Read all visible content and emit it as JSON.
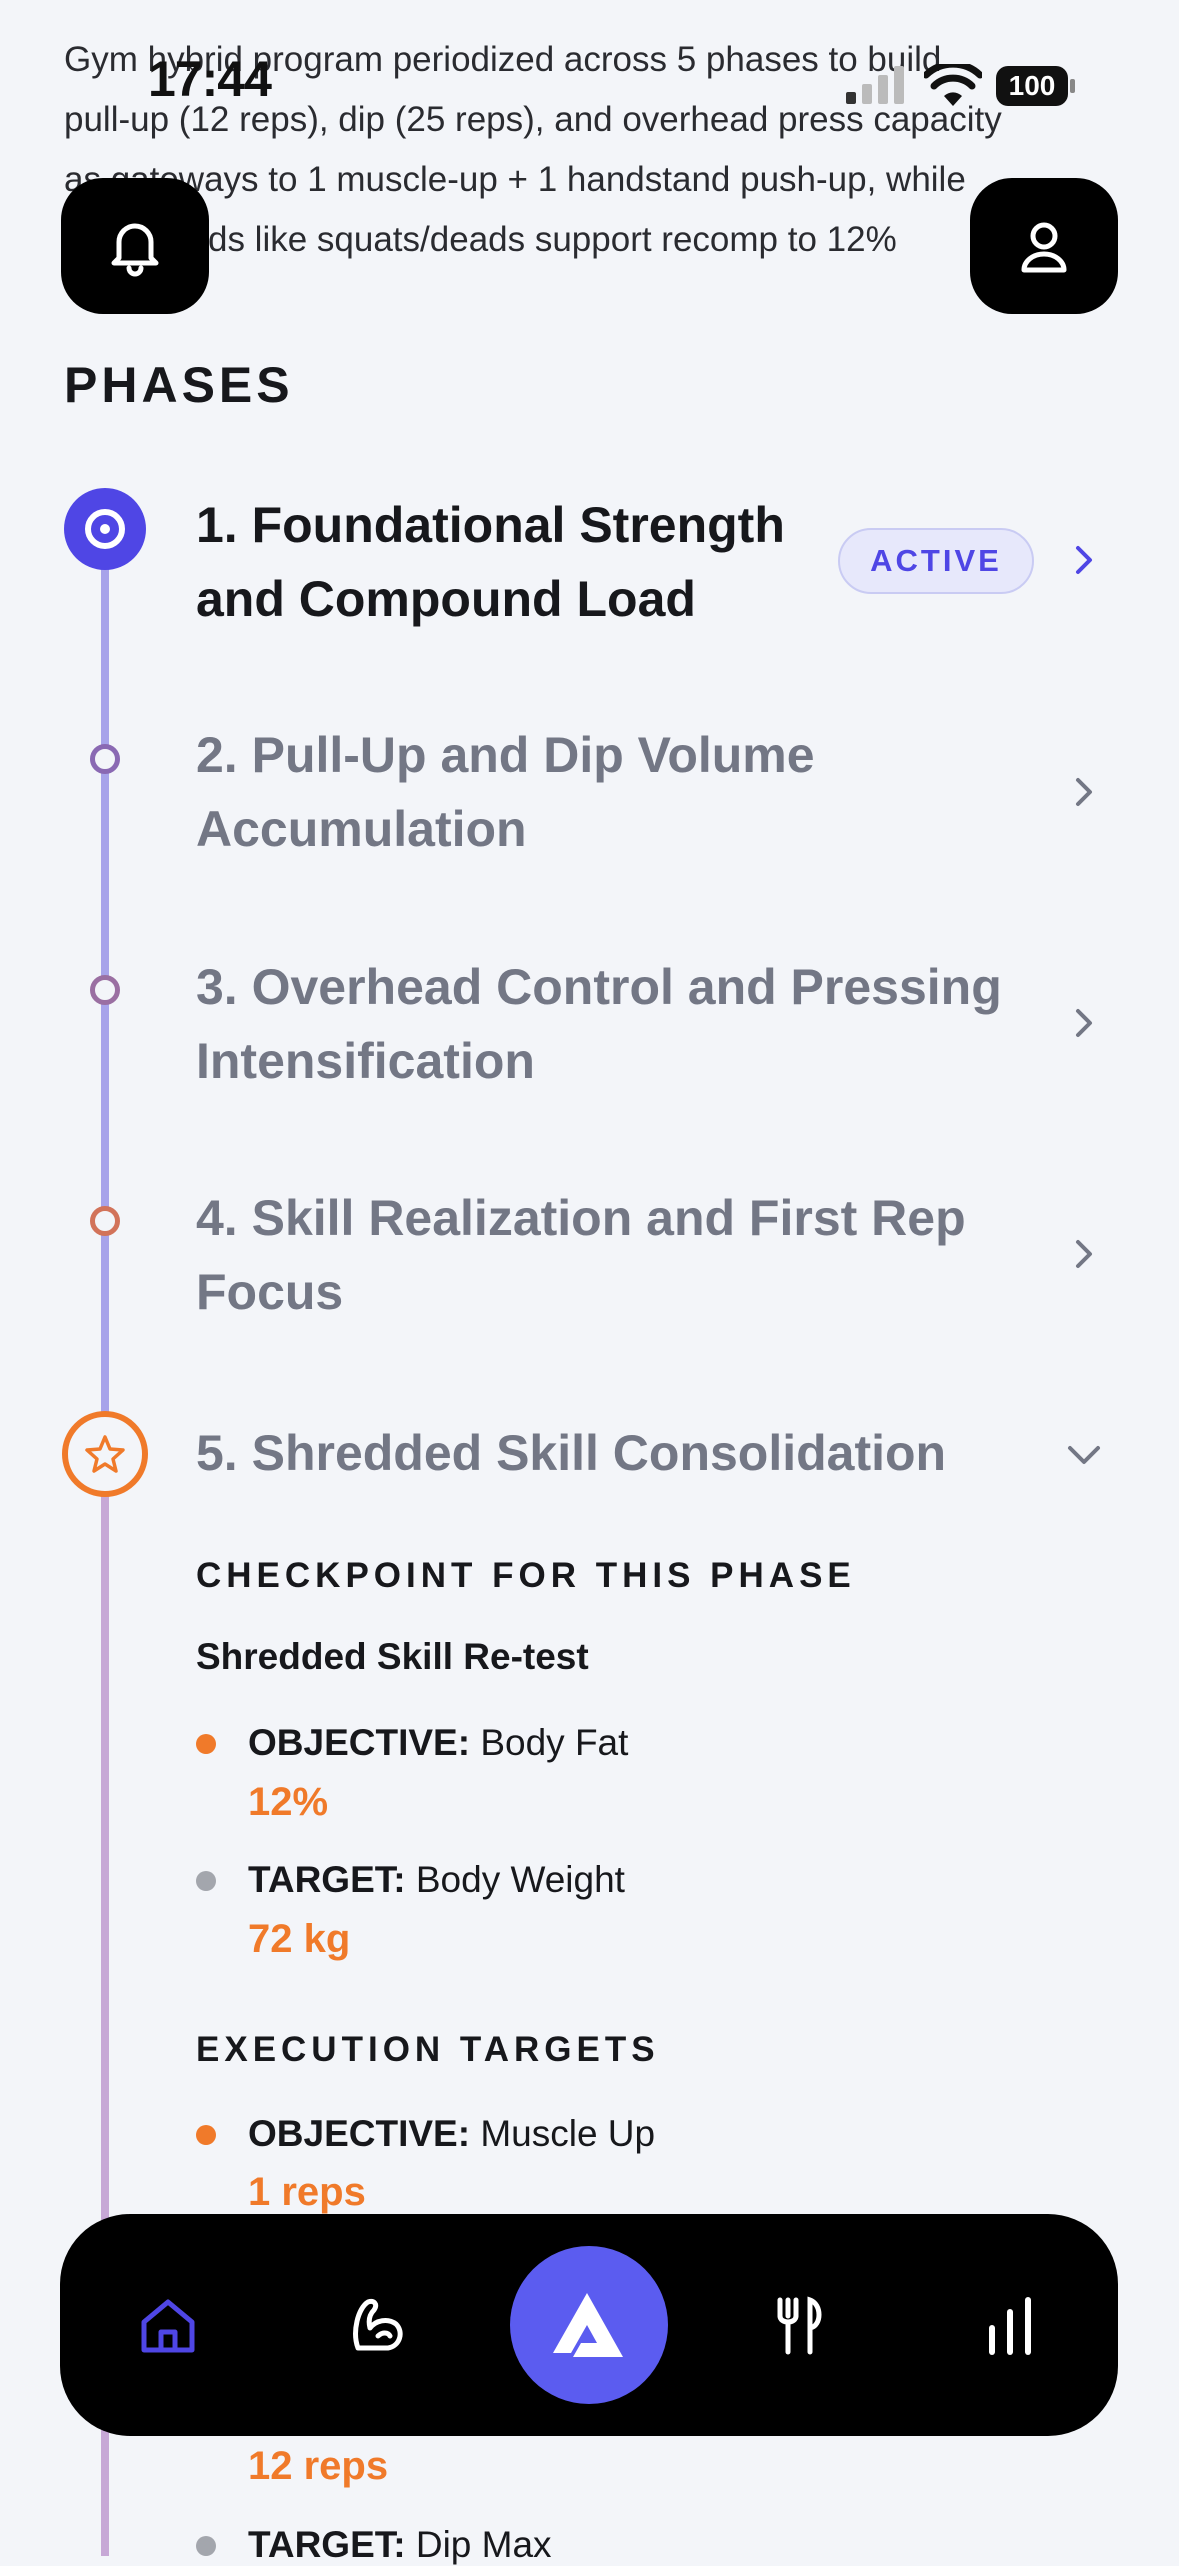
{
  "status_bar": {
    "time": "17:44",
    "battery": "100"
  },
  "intro_lines": [
    "Gym hybrid program periodized across 5 phases to build",
    "pull-up (12 reps), dip (25 reps), and overhead press capacity",
    "as gateways to 1 muscle-up + 1 handstand push-up, while",
    "compounds like squats/deads support recomp to 12%"
  ],
  "section_title": "PHASES",
  "phases": [
    {
      "title": "1. Foundational Strength and Compound Load",
      "badge": "ACTIVE",
      "state": "active"
    },
    {
      "title": "2. Pull-Up and Dip Volume Accumulation",
      "state": "upcoming"
    },
    {
      "title": "3. Overhead Control and Pressing Intensification",
      "state": "upcoming"
    },
    {
      "title": "4. Skill Realization and First Rep Focus",
      "state": "upcoming"
    },
    {
      "title": "5. Shredded Skill Consolidation",
      "state": "expanded"
    }
  ],
  "phase5": {
    "checkpoint_heading": "CHECKPOINT FOR THIS PHASE",
    "checkpoint_name": "Shredded Skill Re-test",
    "checkpoint_items": [
      {
        "kind": "OBJECTIVE:",
        "metric": "Body Fat",
        "value": "12%"
      },
      {
        "kind": "TARGET:",
        "metric": "Body Weight",
        "value": "72 kg"
      }
    ],
    "execution_heading": "EXECUTION TARGETS",
    "execution_items": [
      {
        "kind": "OBJECTIVE:",
        "metric": "Muscle Up",
        "value": "1 reps"
      },
      {
        "value": "12 reps"
      },
      {
        "kind": "TARGET:",
        "metric": "Dip Max"
      }
    ]
  },
  "colors": {
    "accent": "#4f46e5",
    "orange": "#f07a2a",
    "timeline_top": "#a7a3ea",
    "timeline_bottom": "#c7a8d6"
  },
  "tabs": [
    "home-icon",
    "flexed-arm-icon",
    "app-logo-icon",
    "fork-knife-icon",
    "stats-icon"
  ]
}
